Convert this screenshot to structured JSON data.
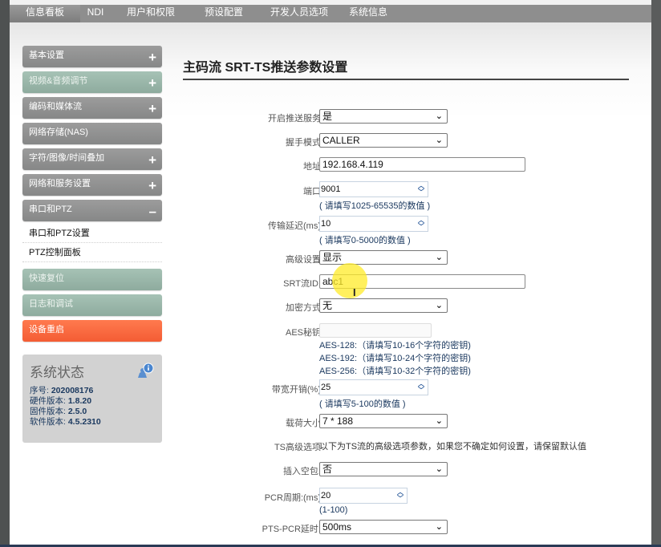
{
  "topnav": {
    "items": [
      {
        "label": "信息看板",
        "active": true
      },
      {
        "label": "NDI",
        "active": false
      },
      {
        "label": "用户和权限",
        "active": false
      },
      {
        "label": "预设配置",
        "active": false
      },
      {
        "label": "开发人员选项",
        "active": false
      },
      {
        "label": "系统信息",
        "active": false
      }
    ]
  },
  "sidebar": {
    "items": [
      {
        "label": "基本设置",
        "toggle": "+"
      },
      {
        "label": "视频&音频调节",
        "toggle": "+"
      },
      {
        "label": "编码和媒体流",
        "toggle": "+"
      },
      {
        "label": "网络存储(NAS)",
        "toggle": ""
      },
      {
        "label": "字符/图像/时间叠加",
        "toggle": "+"
      },
      {
        "label": "网络和服务设置",
        "toggle": "+"
      },
      {
        "label": "串口和PTZ",
        "toggle": "–"
      },
      {
        "label": "快速复位",
        "toggle": ""
      },
      {
        "label": "日志和调试",
        "toggle": ""
      },
      {
        "label": "设备重启",
        "toggle": ""
      }
    ],
    "sub_items": [
      {
        "label": "串口和PTZ设置"
      },
      {
        "label": "PTZ控制面板"
      }
    ],
    "status": {
      "title": "系统状态",
      "icon": "user-info-icon",
      "serial_label": "序号:",
      "serial_value": "202008176",
      "hw_label": "硬件版本:",
      "hw_value": "1.8.20",
      "fw_label": "固件版本:",
      "fw_value": "2.5.0",
      "sw_label": "软件版本:",
      "sw_value": "4.5.2310"
    }
  },
  "main": {
    "title": "主码流 SRT-TS推送参数设置",
    "fields": {
      "push_service": {
        "label": "开启推送服务",
        "value": "是"
      },
      "handshake": {
        "label": "握手模式",
        "value": "CALLER"
      },
      "address": {
        "label": "地址",
        "value": "192.168.4.119"
      },
      "port": {
        "label": "端口",
        "value": "9001",
        "hint": "( 请填写1025-65535的数值 )"
      },
      "latency": {
        "label": "传输延迟(ms)",
        "value": "10",
        "hint": "( 请填写0-5000的数值 )"
      },
      "advanced": {
        "label": "高级设置",
        "value": "显示"
      },
      "stream_id": {
        "label": "SRT流ID:",
        "value": "abc1"
      },
      "encryption": {
        "label": "加密方式",
        "value": "无"
      },
      "aes_key": {
        "label": "AES秘钥",
        "value": "",
        "hints": [
          "AES-128:（请填写10-16个字符的密钥)",
          "AES-192:（请填写10-24个字符的密钥)",
          "AES-256:（请填写10-32个字符的密钥)"
        ]
      },
      "bandwidth": {
        "label": "带宽开销(%)",
        "value": "25",
        "hint": "( 请填写5-100的数值 )"
      },
      "payload": {
        "label": "载荷大小",
        "value": "7 * 188"
      },
      "ts_advanced": {
        "label": "TS高级选项",
        "text": "以下为TS流的高级选项参数，如果您不确定如何设置，请保留默认值"
      },
      "null_packet": {
        "label": "插入空包:",
        "value": "否"
      },
      "pcr_period": {
        "label": "PCR周期:(ms)",
        "value": "20",
        "hint": "(1-100)"
      },
      "pts_pcr": {
        "label": "PTS-PCR延时:",
        "value": "500ms"
      }
    }
  }
}
